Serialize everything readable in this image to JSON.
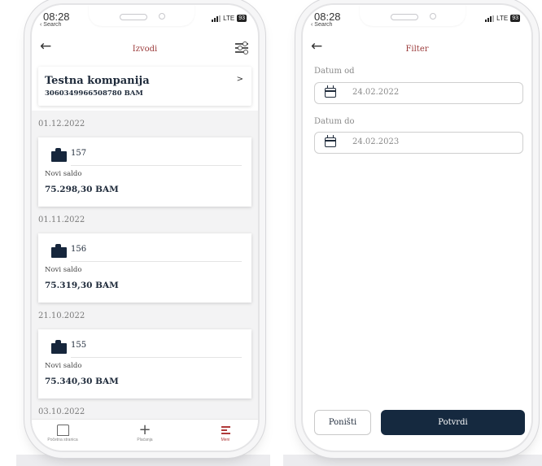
{
  "left_screen": {
    "status": {
      "time": "08:28",
      "back_app": "‹ Search",
      "network": "LTE",
      "battery": "93"
    },
    "header": {
      "back_icon": "arrow-left-icon",
      "title": "Izvodi",
      "filter_icon": "sliders-icon"
    },
    "company": {
      "name": "Testna kompanija",
      "account": "3060349966508780 BAM",
      "chevron": ">"
    },
    "statements": [
      {
        "date": "01.12.2022",
        "number": "157",
        "balance_label": "Novi saldo",
        "balance": "75.298,30 BAM"
      },
      {
        "date": "01.11.2022",
        "number": "156",
        "balance_label": "Novi saldo",
        "balance": "75.319,30 BAM"
      },
      {
        "date": "21.10.2022",
        "number": "155",
        "balance_label": "Novi saldo",
        "balance": "75.340,30 BAM"
      }
    ],
    "next_date": "03.10.2022",
    "tabbar": [
      {
        "label": "Početna stranica",
        "icon": "home-icon"
      },
      {
        "label": "Plaćanja",
        "icon": "plus-icon"
      },
      {
        "label": "Meni",
        "icon": "menu-icon",
        "active": true
      }
    ],
    "colors": {
      "accent": "#9b3b3b",
      "navy": "#15293f"
    }
  },
  "right_screen": {
    "status": {
      "time": "08:28",
      "back_app": "‹ Search",
      "network": "LTE",
      "battery": "93"
    },
    "header": {
      "back_icon": "arrow-left-icon",
      "title": "Filter"
    },
    "date_from": {
      "label": "Datum od",
      "value": "24.02.2022",
      "icon": "calendar-icon"
    },
    "date_to": {
      "label": "Datum do",
      "value": "24.02.2023",
      "icon": "calendar-icon"
    },
    "buttons": {
      "reset": "Poništi",
      "confirm": "Potvrdi"
    }
  }
}
